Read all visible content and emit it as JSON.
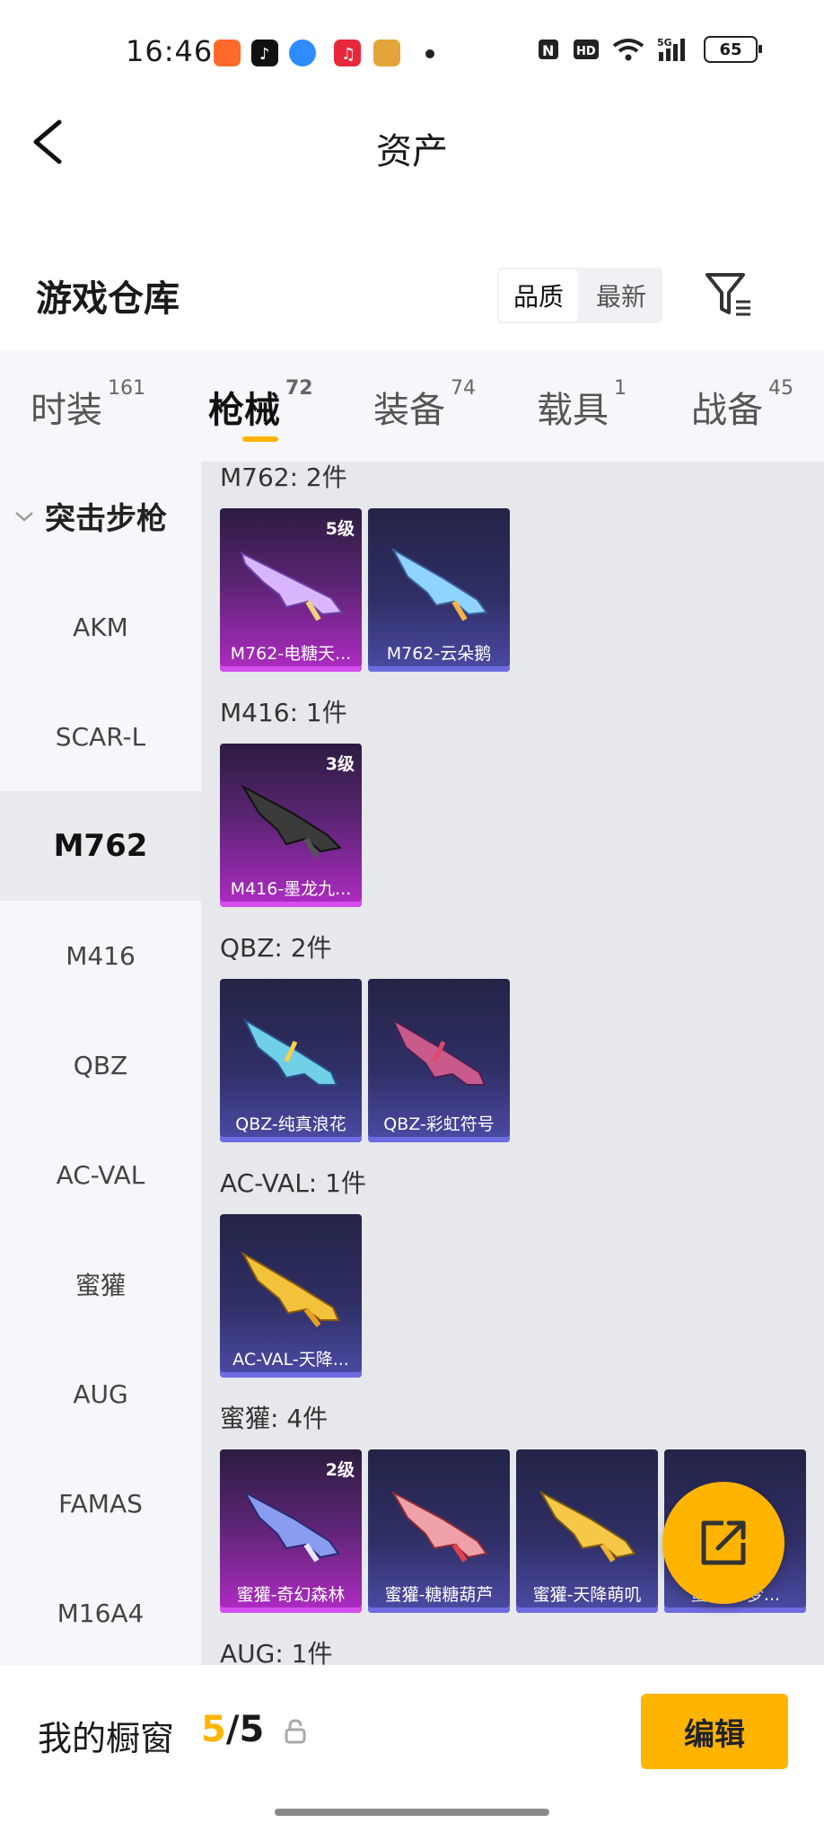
{
  "status_bar": {
    "time": "16:46",
    "battery": "65",
    "network": "5G"
  },
  "header": {
    "title": "资产"
  },
  "warehouse": {
    "title": "游戏仓库",
    "sort_options": [
      "品质",
      "最新"
    ],
    "active_sort": "品质"
  },
  "tabs": [
    {
      "label": "时装",
      "count": "161"
    },
    {
      "label": "枪械",
      "count": "72"
    },
    {
      "label": "装备",
      "count": "74"
    },
    {
      "label": "载具",
      "count": "1"
    },
    {
      "label": "战备",
      "count": "45"
    }
  ],
  "active_tab": "枪械",
  "sidebar": {
    "group": "突击步枪",
    "items": [
      "AKM",
      "SCAR-L",
      "M762",
      "M416",
      "QBZ",
      "AC-VAL",
      "蜜獾",
      "AUG",
      "FAMAS",
      "M16A4"
    ],
    "active": "M762"
  },
  "sections": [
    {
      "label": "M762: 2件",
      "items": [
        {
          "name": "M762-电糖天...",
          "level": "5级",
          "rarity": "purple"
        },
        {
          "name": "M762-云朵鹅",
          "level": "",
          "rarity": "blue"
        }
      ]
    },
    {
      "label": "M416: 1件",
      "items": [
        {
          "name": "M416-墨龙九...",
          "level": "3级",
          "rarity": "purple"
        }
      ]
    },
    {
      "label": "QBZ: 2件",
      "items": [
        {
          "name": "QBZ-纯真浪花",
          "level": "",
          "rarity": "blue"
        },
        {
          "name": "QBZ-彩虹符号",
          "level": "",
          "rarity": "blue"
        }
      ]
    },
    {
      "label": "AC-VAL: 1件",
      "items": [
        {
          "name": "AC-VAL-天降...",
          "level": "",
          "rarity": "blue"
        }
      ]
    },
    {
      "label": "蜜獾: 4件",
      "items": [
        {
          "name": "蜜獾-奇幻森林",
          "level": "2级",
          "rarity": "purple"
        },
        {
          "name": "蜜獾-糖糖葫芦",
          "level": "",
          "rarity": "blue"
        },
        {
          "name": "蜜獾-天降萌叽",
          "level": "",
          "rarity": "blue"
        },
        {
          "name": "蜜獾-...梦...",
          "level": "",
          "rarity": "blue"
        }
      ]
    },
    {
      "label": "AUG: 1件",
      "items": []
    }
  ],
  "showcase": {
    "label": "我的橱窗",
    "current": "5",
    "total": "/5",
    "edit_label": "编辑"
  },
  "colors": {
    "accent": "#ffb400",
    "purple": "#b02bc4",
    "blue": "#4c4ba6"
  }
}
